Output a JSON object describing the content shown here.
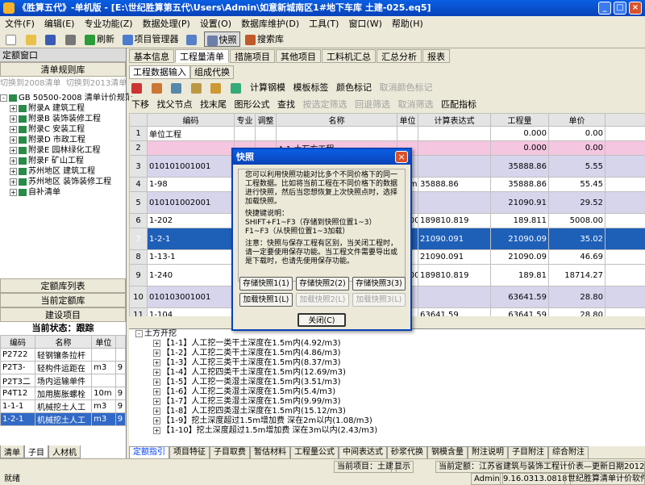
{
  "window": {
    "title": "《胜算五代》-单机版 - [E:\\世纪胜算第五代\\Users\\Admin\\如意新城南区1#地下车库 土建-025.eq5]"
  },
  "menu": [
    "文件(F)",
    "编辑(E)",
    "专业功能(Z)",
    "数据处理(P)",
    "设置(O)",
    "数据库维护(D)",
    "工具(T)",
    "窗口(W)",
    "帮助(H)"
  ],
  "toolbar": {
    "refresh": "刷新",
    "project_manager": "项目管理器",
    "snapshot": "快照",
    "search_lib": "搜索库"
  },
  "left": {
    "header": "定额窗口",
    "btn_list_lib": "清单规则库",
    "switch_2008": "切换到2008清单",
    "switch_2013": "切换到2013清单",
    "tree": [
      "GB 50500-2008 清单计价规范",
      "附录A 建筑工程",
      "附录B 装饰装修工程",
      "附录C 安装工程",
      "附录D 市政工程",
      "附录E 园林绿化工程",
      "附录F 矿山工程",
      "苏州地区 建筑工程",
      "苏州地区 装饰装修工程",
      "自补清单"
    ],
    "btn_quota_list": "定额库列表",
    "btn_current_quota": "当前定额库",
    "btn_build_item": "建设项目",
    "status_label": "当前状态：跟踪",
    "table_headers": [
      "编码",
      "名称",
      "单位",
      ""
    ],
    "table_rows": [
      [
        "P2722",
        "轻钢镶条拉杆",
        "",
        ""
      ],
      [
        "P2T3-",
        "轻构件运距在",
        "m3",
        "9"
      ],
      [
        "P2T3二",
        "场内运输单件",
        "",
        ""
      ],
      [
        "P4T12",
        "加用膨胀螺栓",
        "10m",
        "9"
      ],
      [
        "1-1-1",
        "机械挖土人工",
        "m3",
        "9"
      ],
      [
        "1-2-1",
        "机械挖土人工",
        "m3",
        "9"
      ]
    ],
    "bottom_tabs": [
      "清单",
      "子目",
      "人材机"
    ]
  },
  "main": {
    "tabs": [
      "基本信息",
      "工程量清单",
      "措施项目",
      "其他项目",
      "工料机汇总",
      "汇总分析",
      "报表"
    ],
    "subtabs": [
      "工程数据输入",
      "组成代换"
    ],
    "toolbar2": [
      "计算钢模",
      "模板标签",
      "颜色标记",
      "取消颜色标记"
    ],
    "toolbar3": [
      "下移",
      "找父节点",
      "找末尾",
      "图形公式",
      "查找",
      "按选定筛选",
      "回退筛选",
      "取消筛选",
      "匹配指标"
    ],
    "grid_headers": [
      "编码",
      "专业",
      "调整",
      "名称",
      "单位",
      "计算表达式",
      "工程量",
      "单价"
    ],
    "grid_rows": [
      {
        "n": "1",
        "code": "单位工程",
        "name": "",
        "unit": "",
        "expr": "",
        "qty": "0.000",
        "price": "0.00",
        "style": ""
      },
      {
        "n": "2",
        "code": "",
        "name": "A.1 土石方工程",
        "unit": "",
        "expr": "",
        "qty": "0.000",
        "price": "0.00",
        "style": "pink"
      },
      {
        "n": "3",
        "code": "010101001001",
        "name": "",
        "unit": "m2",
        "expr": "",
        "qty": "35888.86",
        "price": "5.55",
        "style": "lav"
      },
      {
        "n": "4",
        "code": "1-98",
        "name": "",
        "unit": "10m2",
        "expr": "35888.86",
        "qty": "35888.86",
        "price": "55.45",
        "style": ""
      },
      {
        "n": "5",
        "code": "010101002001",
        "name": "",
        "unit": "m3",
        "expr": "",
        "qty": "21090.91",
        "price": "29.52",
        "style": "lav"
      },
      {
        "n": "6",
        "code": "1-202",
        "name": "",
        "unit": "1000m3",
        "expr": "189810.819",
        "qty": "189.811",
        "price": "5008.00",
        "style": ""
      },
      {
        "n": "7",
        "code": "1-2-1",
        "name": "在1.5m以",
        "unit": "m3",
        "expr": "21090.091",
        "qty": "21090.09",
        "price": "35.02",
        "style": "blue"
      },
      {
        "n": "8",
        "code": "1-13-1",
        "name": "内超过",
        "unit": "m3",
        "expr": "21090.091",
        "qty": "21090.09",
        "price": "46.69",
        "style": ""
      },
      {
        "n": "9",
        "code": "1-240",
        "name": "",
        "unit": "1000m3",
        "expr": "189810.819",
        "qty": "189.81",
        "price": "18714.27",
        "style": ""
      },
      {
        "n": "10",
        "code": "010103001001",
        "name": "",
        "unit": "m3",
        "expr": "",
        "qty": "63641.59",
        "price": "28.80",
        "style": "lav"
      },
      {
        "n": "11",
        "code": "1-104",
        "name": "",
        "unit": "m3",
        "expr": "63641.59",
        "qty": "63641.59",
        "price": "28.80",
        "style": ""
      }
    ],
    "bottom_tree": [
      "土方开挖",
      "【1-1】人工挖一类干土深度在1.5m内(4.92/m3)",
      "【1-2】人工挖二类干土深度在1.5m内(4.86/m3)",
      "【1-3】人工挖三类干土深度在1.5m内(8.37/m3)",
      "【1-4】人工挖四类干土深度在1.5m内(12.69/m3)",
      "【1-5】人工挖一类湿土深度在1.5m内(3.51/m3)",
      "【1-6】人工挖二类湿土深度在1.5m内(5.4/m3)",
      "【1-7】人工挖三类湿土深度在1.5m内(9.99/m3)",
      "【1-8】人工挖四类湿土深度在1.5m内(15.12/m3)",
      "【1-9】挖土深度超过1.5m增加费 深在2m以内(1.08/m3)",
      "【1-10】挖土深度超过1.5m增加费 深在3m以内(2.43/m3)"
    ],
    "bottom_tabs": [
      "定额指引",
      "项目特征",
      "子目取费",
      "暂估材料",
      "工程量公式",
      "中间表达式",
      "砂浆代换",
      "钢模含量",
      "附注说明",
      "子目附注",
      "综合附注"
    ]
  },
  "dialog": {
    "title": "快照",
    "text": "您可以利用快照功能对比多个不同价格下的同一工程数据。比如将当前工程在不同价格下的数据进行快照，然后当您想恢复上次快照点时，选择加载快照。",
    "shortcut_title": "快捷键说明：",
    "shortcut1": "SHIFT+F1~F3（存储到快照位置1~3）",
    "shortcut2": "F1~F3（从快照位置1~3加载）",
    "note": "注意：快照与保存工程有区别，当关闭工程时，请一定要使用保存功能。当工程文件需要导出或是下载时，也请先使用保存功能。",
    "btn_save1": "存储快照1(1)",
    "btn_save2": "存储快照2(2)",
    "btn_save3": "存储快照3(3)",
    "btn_load1": "加载快照1(L)",
    "btn_load2": "加载快照2(L)",
    "btn_load3": "加载快照3(L)",
    "btn_close": "关闭(C)"
  },
  "status": {
    "ready": "就绪",
    "current_project": "当前项目：土建",
    "display": "显示",
    "current_quota": "当前定额：江苏省建筑与装饰工程计价表—更新日期2012-01-01",
    "user": "Admin",
    "version": "9.16.0313.0818",
    "company": "世纪胜算清单计价软件"
  }
}
